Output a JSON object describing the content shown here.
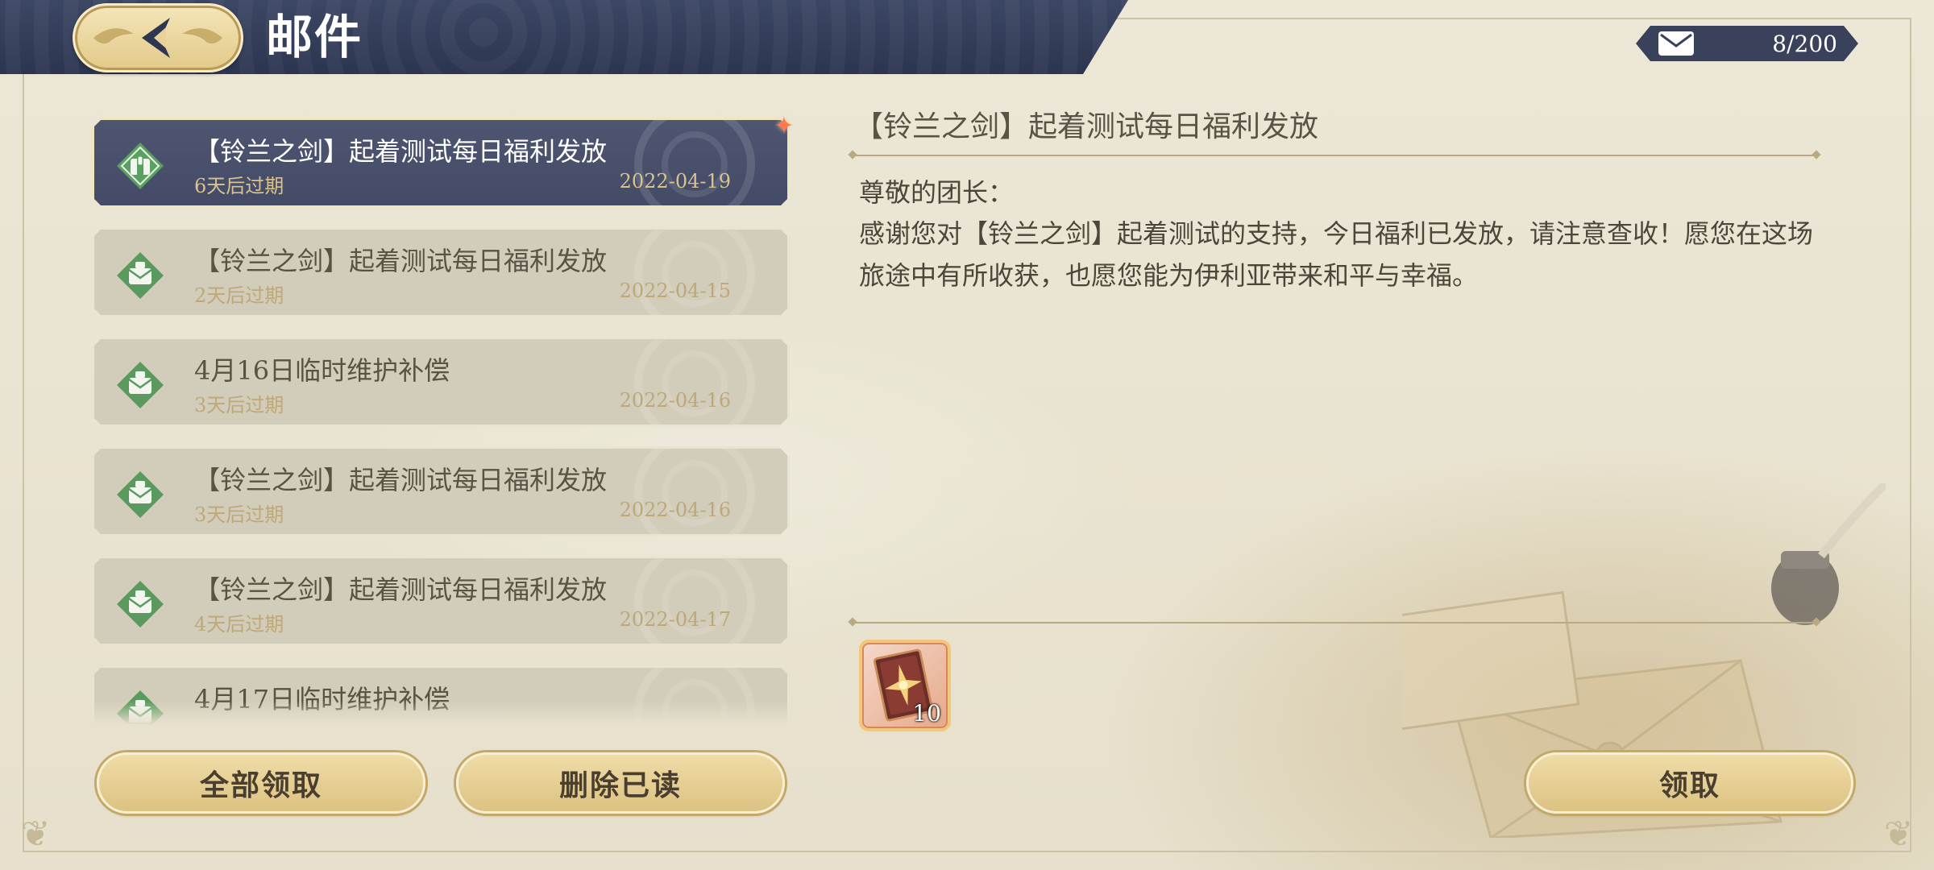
{
  "header": {
    "title": "邮件",
    "back_icon": "back-arrow-icon"
  },
  "mail_count": {
    "icon": "envelope-icon",
    "text": "8/200"
  },
  "mail_list": [
    {
      "title": "【铃兰之剑】起着测试每日福利发放",
      "expire": "6天后过期",
      "date": "2022-04-19",
      "selected": true,
      "new": true
    },
    {
      "title": "【铃兰之剑】起着测试每日福利发放",
      "expire": "2天后过期",
      "date": "2022-04-15",
      "selected": false
    },
    {
      "title": "4月16日临时维护补偿",
      "expire": "3天后过期",
      "date": "2022-04-16",
      "selected": false
    },
    {
      "title": "【铃兰之剑】起着测试每日福利发放",
      "expire": "3天后过期",
      "date": "2022-04-16",
      "selected": false
    },
    {
      "title": "【铃兰之剑】起着测试每日福利发放",
      "expire": "4天后过期",
      "date": "2022-04-17",
      "selected": false
    },
    {
      "title": "4月17日临时维护补偿",
      "expire": "",
      "date": "",
      "selected": false
    }
  ],
  "buttons": {
    "claim_all": "全部领取",
    "delete_read": "删除已读",
    "claim": "领取"
  },
  "detail": {
    "title": "【铃兰之剑】起着测试每日福利发放",
    "greeting": "尊敬的团长：",
    "body": "感谢您对【铃兰之剑】起着测试的支持，今日福利已发放，请注意查收！愿您在这场旅途中有所收获，也愿您能为伊利亚带来和平与幸福。",
    "reward": {
      "icon": "card-item-icon",
      "quantity": "10"
    }
  },
  "colors": {
    "header_navy": "#2c3550",
    "selected_item": "#4d5571",
    "gold_button": "#dcc283",
    "parchment": "#eae4d0",
    "mail_icon_green": "#5a9a5e"
  }
}
